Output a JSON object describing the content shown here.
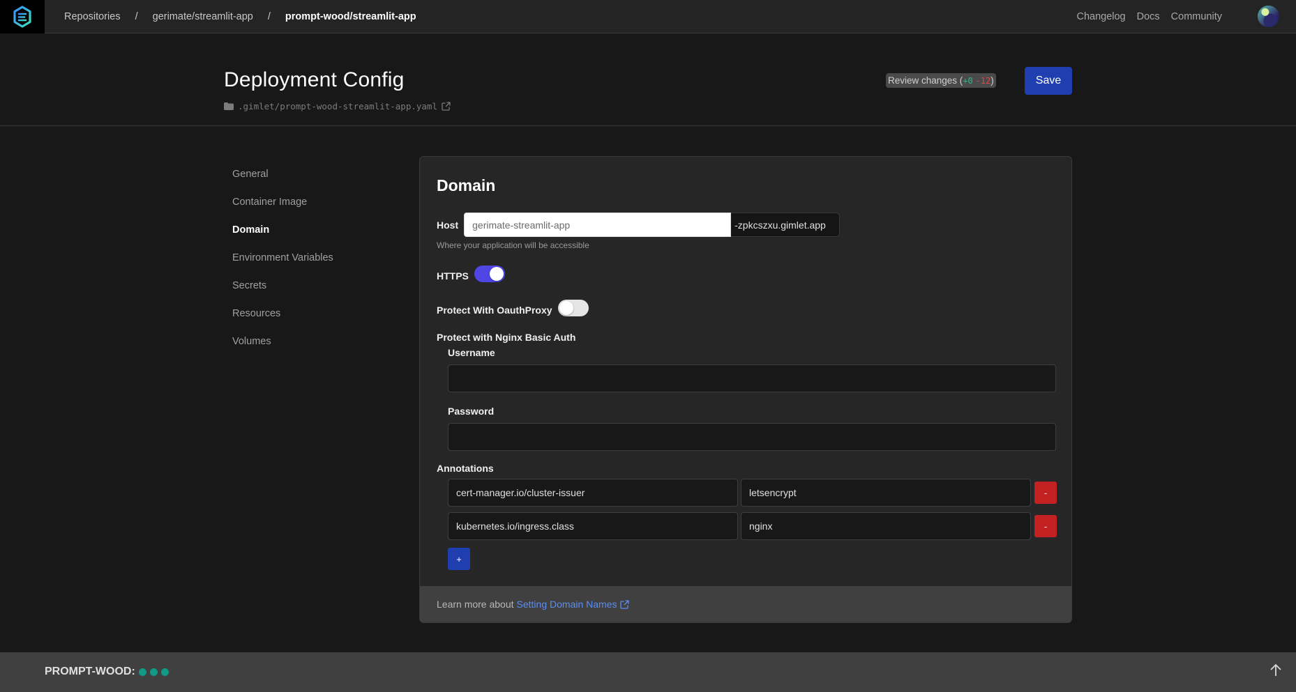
{
  "navbar": {
    "logo": "gimlet-logo-icon",
    "breadcrumbs": [
      "Repositories",
      "gerimate/streamlit-app",
      "prompt-wood/streamlit-app"
    ],
    "separator": "/",
    "links": [
      "Changelog",
      "Docs",
      "Community"
    ],
    "avatar": "user-avatar"
  },
  "header": {
    "title": "Deployment Config",
    "file_path": ".gimlet/prompt-wood-streamlit-app.yaml",
    "review": {
      "label": "Review changes (",
      "additions": "+0",
      "deletions": "-12",
      "close": ")"
    },
    "save_label": "Save"
  },
  "sidebar": {
    "items": [
      {
        "label": "General",
        "active": false
      },
      {
        "label": "Container Image",
        "active": false
      },
      {
        "label": "Domain",
        "active": true
      },
      {
        "label": "Environment Variables",
        "active": false
      },
      {
        "label": "Secrets",
        "active": false
      },
      {
        "label": "Resources",
        "active": false
      },
      {
        "label": "Volumes",
        "active": false
      }
    ]
  },
  "domain": {
    "title": "Domain",
    "host": {
      "label": "Host",
      "value": "gerimate-streamlit-app",
      "suffix": "-zpkcszxu.gimlet.app",
      "help": "Where your application will be accessible"
    },
    "https": {
      "label": "HTTPS",
      "enabled": true
    },
    "oauth": {
      "label": "Protect With OauthProxy",
      "enabled": false
    },
    "nginx": {
      "label": "Protect with Nginx Basic Auth",
      "username_label": "Username",
      "username_value": "",
      "password_label": "Password",
      "password_value": ""
    },
    "annotations": {
      "label": "Annotations",
      "rows": [
        {
          "key": "cert-manager.io/cluster-issuer",
          "value": "letsencrypt"
        },
        {
          "key": "kubernetes.io/ingress.class",
          "value": "nginx"
        }
      ],
      "remove_label": "-",
      "add_label": "+"
    },
    "footer": {
      "text": "Learn more about",
      "link": "Setting Domain Names"
    }
  },
  "bottombar": {
    "brand": "PROMPT-WOOD:",
    "status_dots": 3,
    "dot_color": "#0f9a86"
  },
  "colors": {
    "accent": "#1f3fb0",
    "toggle_on": "#4f46e5",
    "danger": "#c42222",
    "link": "#5b8ef0"
  }
}
